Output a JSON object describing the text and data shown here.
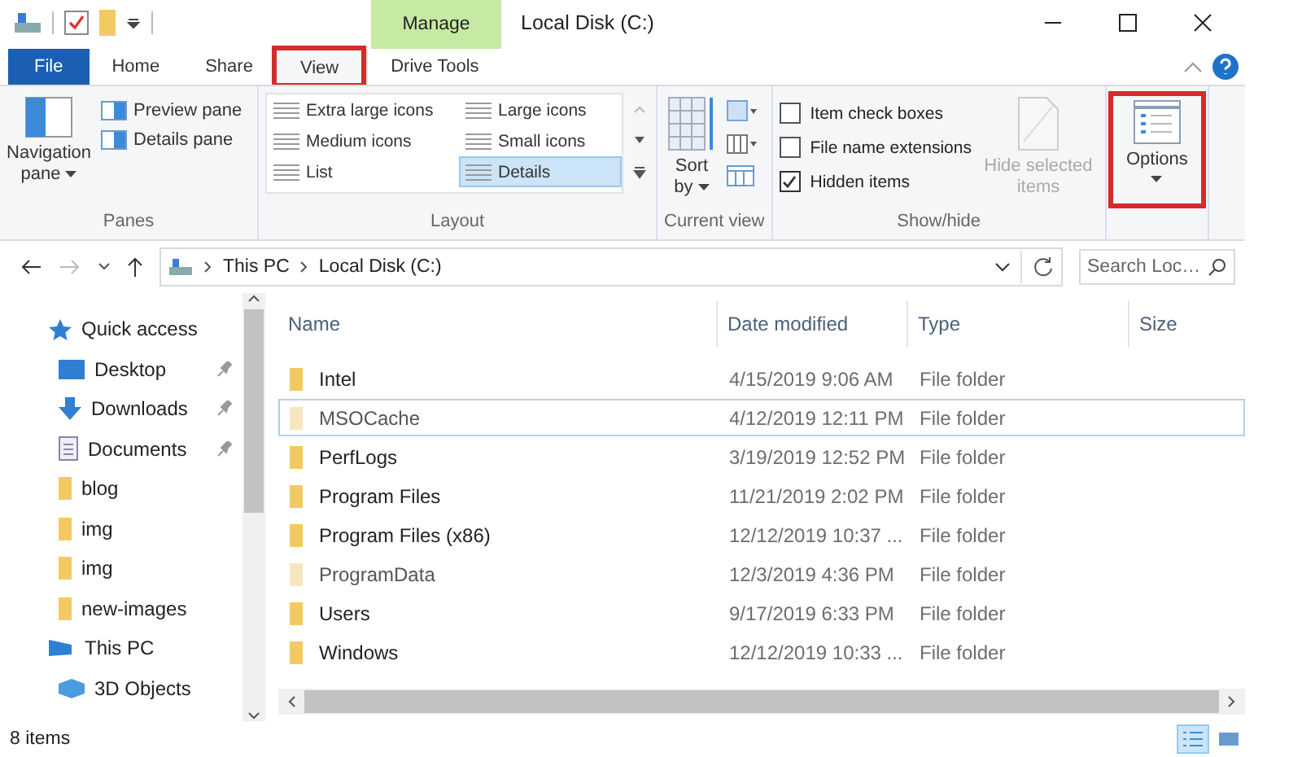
{
  "window": {
    "title": "Local Disk (C:)"
  },
  "context_tab": {
    "label": "Manage"
  },
  "tabs": [
    {
      "label": "File",
      "kind": "file",
      "selected": false,
      "highlighted": false
    },
    {
      "label": "Home",
      "kind": "plain",
      "selected": false,
      "highlighted": false
    },
    {
      "label": "Share",
      "kind": "plain",
      "selected": false,
      "highlighted": false
    },
    {
      "label": "View",
      "kind": "plain",
      "selected": true,
      "highlighted": true
    },
    {
      "label": "Drive Tools",
      "kind": "context",
      "selected": false,
      "highlighted": false
    }
  ],
  "ribbon": {
    "panes": {
      "title": "Panes",
      "navigation_pane": "Navigation pane",
      "preview_pane": "Preview pane",
      "details_pane": "Details pane"
    },
    "layout": {
      "title": "Layout",
      "options": [
        {
          "label": "Extra large icons",
          "selected": false
        },
        {
          "label": "Large icons",
          "selected": false
        },
        {
          "label": "Medium icons",
          "selected": false
        },
        {
          "label": "Small icons",
          "selected": false
        },
        {
          "label": "List",
          "selected": false
        },
        {
          "label": "Details",
          "selected": true
        }
      ]
    },
    "current_view": {
      "title": "Current view",
      "sort_by": "Sort by"
    },
    "show_hide": {
      "title": "Show/hide",
      "checkboxes": [
        {
          "label": "Item check boxes",
          "checked": false
        },
        {
          "label": "File name extensions",
          "checked": false
        },
        {
          "label": "Hidden items",
          "checked": true
        }
      ],
      "hide_selected": {
        "label": "Hide selected items",
        "disabled": true
      }
    },
    "options": {
      "label": "Options",
      "highlighted": true
    }
  },
  "address": {
    "crumbs": [
      "This PC",
      "Local Disk (C:)"
    ],
    "search_placeholder": "Search Loc…"
  },
  "sidebar": {
    "items": [
      {
        "label": "Quick access",
        "kind": "star",
        "pinned": false,
        "children": [
          {
            "label": "Desktop",
            "kind": "desktop",
            "pinned": true
          },
          {
            "label": "Downloads",
            "kind": "download",
            "pinned": true
          },
          {
            "label": "Documents",
            "kind": "document",
            "pinned": true
          },
          {
            "label": "blog",
            "kind": "folder",
            "pinned": false
          },
          {
            "label": "img",
            "kind": "folder",
            "pinned": false
          },
          {
            "label": "img",
            "kind": "folder",
            "pinned": false
          },
          {
            "label": "new-images",
            "kind": "folder",
            "pinned": false
          }
        ]
      },
      {
        "label": "This PC",
        "kind": "pc",
        "pinned": false,
        "children": [
          {
            "label": "3D Objects",
            "kind": "objects",
            "pinned": false
          }
        ]
      }
    ]
  },
  "table": {
    "columns": [
      "Name",
      "Date modified",
      "Type",
      "Size"
    ],
    "rows": [
      {
        "name": "Intel",
        "date": "4/15/2019 9:06 AM",
        "type": "File folder",
        "hidden": false,
        "selected": false
      },
      {
        "name": "MSOCache",
        "date": "4/12/2019 12:11 PM",
        "type": "File folder",
        "hidden": true,
        "selected": true
      },
      {
        "name": "PerfLogs",
        "date": "3/19/2019 12:52 PM",
        "type": "File folder",
        "hidden": false,
        "selected": false
      },
      {
        "name": "Program Files",
        "date": "11/21/2019 2:02 PM",
        "type": "File folder",
        "hidden": false,
        "selected": false
      },
      {
        "name": "Program Files (x86)",
        "date": "12/12/2019 10:37 ...",
        "type": "File folder",
        "hidden": false,
        "selected": false
      },
      {
        "name": "ProgramData",
        "date": "12/3/2019 4:36 PM",
        "type": "File folder",
        "hidden": true,
        "selected": false
      },
      {
        "name": "Users",
        "date": "9/17/2019 6:33 PM",
        "type": "File folder",
        "hidden": false,
        "selected": false
      },
      {
        "name": "Windows",
        "date": "12/12/2019 10:33 ...",
        "type": "File folder",
        "hidden": false,
        "selected": false
      }
    ]
  },
  "status_bar": {
    "text": "8 items",
    "views": [
      {
        "kind": "details",
        "selected": true
      },
      {
        "kind": "tiles",
        "selected": false
      }
    ]
  }
}
